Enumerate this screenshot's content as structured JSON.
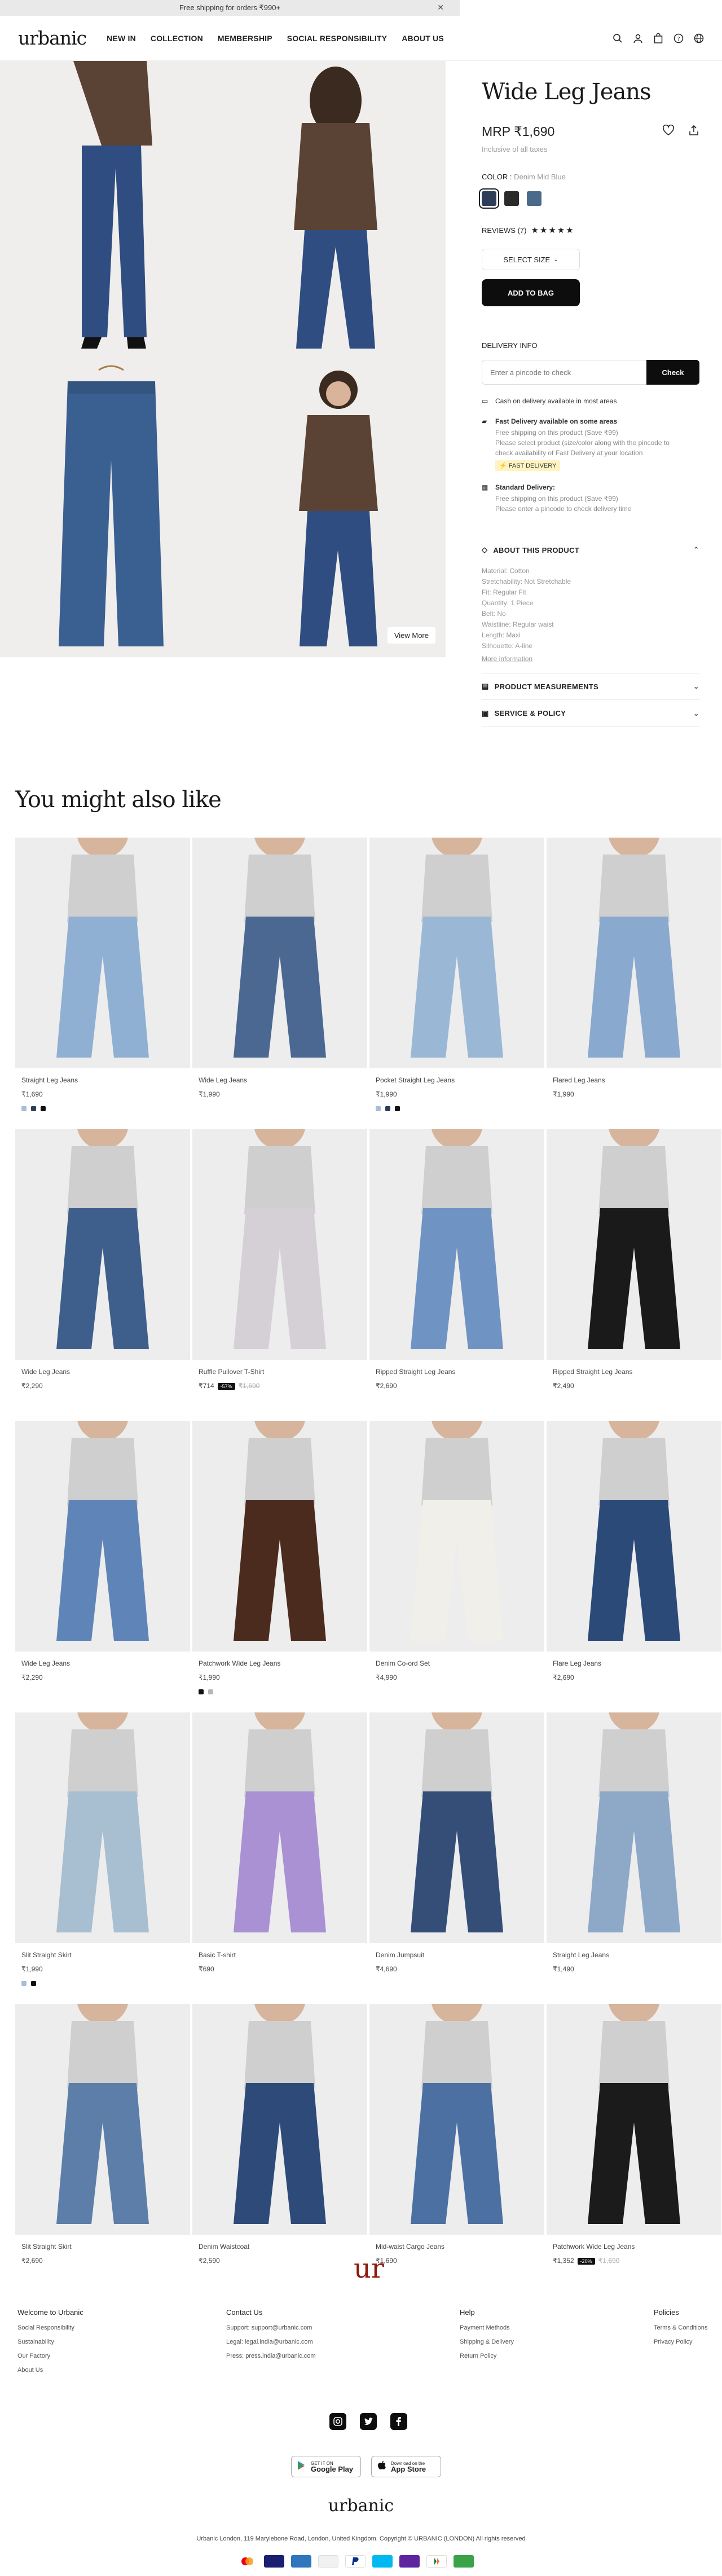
{
  "promo": {
    "text": "Free shipping for orders ₹990+",
    "close": "✕"
  },
  "header": {
    "logo": "urbanic",
    "nav": [
      "NEW IN",
      "COLLECTION",
      "MEMBERSHIP",
      "SOCIAL RESPONSIBILITY",
      "ABOUT US"
    ]
  },
  "gallery": {
    "view_more": "View More"
  },
  "product": {
    "title": "Wide Leg Jeans",
    "price": "MRP ₹1,690",
    "tax_note": "Inclusive of all taxes",
    "color_label": "COLOR : ",
    "color_value": "Denim Mid Blue",
    "swatches": [
      "#2e3e59",
      "#2b2b2b",
      "#4a6a8a"
    ],
    "reviews_label": "REVIEWS (7)",
    "stars": "★★★★★",
    "select_size": "SELECT SIZE",
    "add_to_bag": "ADD TO BAG",
    "delivery_label": "DELIVERY INFO",
    "pincode_placeholder": "Enter a pincode to check",
    "check": "Check",
    "cod": "Cash on delivery available in most areas",
    "fast_title": "Fast Delivery available on some areas",
    "fast_l1": "Free shipping on this product (Save ₹99)",
    "fast_l2": "Please select product (size/color along with the pincode to",
    "fast_l3": "check availability of Fast Delivery at your location",
    "fast_badge": "⚡ FAST DELIVERY",
    "std_title": "Standard Delivery:",
    "std_l1": "Free shipping on this product (Save ₹99)",
    "std_l2": "Please enter a pincode to check delivery time",
    "about": "ABOUT THIS PRODUCT",
    "attrs": [
      "Material: Cotton",
      "Stretchability: Not Stretchable",
      "Fit: Regular Fit",
      "Quantity: 1 Piece",
      "Belt: No",
      "Waistline: Regular waist",
      "Length: Maxi",
      "Silhouette: A-line"
    ],
    "more_info": "More information",
    "measurements": "PRODUCT MEASUREMENTS",
    "service": "SERVICE & POLICY"
  },
  "recs_title": "You might also like",
  "recs": [
    {
      "name": "Straight Leg Jeans",
      "price": "₹1,690",
      "dots": [
        "#a9bdd6",
        "#2c3e5c",
        "#111"
      ],
      "bg": "#8fb0d3"
    },
    {
      "name": "Wide Leg Jeans",
      "price": "₹1,990",
      "dots": [],
      "bg": "#4a6891"
    },
    {
      "name": "Pocket Straight Leg Jeans",
      "price": "₹1,990",
      "dots": [
        "#a9bdd6",
        "#2c3e5c",
        "#111"
      ],
      "bg": "#9ab8d6"
    },
    {
      "name": "Flared Leg Jeans",
      "price": "₹1,990",
      "dots": [],
      "bg": "#8aa9cf"
    },
    {
      "name": "Wide Leg Jeans",
      "price": "₹2,290",
      "dots": [],
      "bg": "#3e5f8c"
    },
    {
      "name": "Ruffle Pullover T-Shirt",
      "price": "₹714",
      "badge": "-57%",
      "old": "₹1,690",
      "dots": [],
      "bg": "#d4d0d6"
    },
    {
      "name": "Ripped Straight Leg Jeans",
      "price": "₹2,690",
      "dots": [],
      "bg": "#6f93c2"
    },
    {
      "name": "Ripped Straight Leg Jeans",
      "price": "₹2,490",
      "dots": [],
      "bg": "#1a1a1a"
    },
    {
      "name": "Wide Leg Jeans",
      "price": "₹2,290",
      "dots": [],
      "bg": "#5f85b8"
    },
    {
      "name": "Patchwork Wide Leg Jeans",
      "price": "₹1,990",
      "dots": [
        "#111",
        "#b7b7b7"
      ],
      "bg": "#4a2b1e"
    },
    {
      "name": "Denim Co-ord Set",
      "price": "₹4,990",
      "dots": [],
      "bg": "#f1efe9"
    },
    {
      "name": "Flare Leg Jeans",
      "price": "₹2,690",
      "dots": [],
      "bg": "#2b4a78"
    },
    {
      "name": "Slit Straight Skirt",
      "price": "₹1,990",
      "dots": [
        "#a9bdd6",
        "#111"
      ],
      "bg": "#a8bfd2"
    },
    {
      "name": "Basic T-shirt",
      "price": "₹690",
      "dots": [],
      "bg": "#a991d3"
    },
    {
      "name": "Denim Jumpsuit",
      "price": "₹4,690",
      "dots": [],
      "bg": "#344e78"
    },
    {
      "name": "Straight Leg Jeans",
      "price": "₹1,490",
      "dots": [],
      "bg": "#8ea8c8"
    },
    {
      "name": "Slit Straight Skirt",
      "price": "₹2,690",
      "dots": [],
      "bg": "#5d7ea8"
    },
    {
      "name": "Denim Waistcoat",
      "price": "₹2,590",
      "dots": [],
      "bg": "#2e4a78"
    },
    {
      "name": "Mid-waist Cargo Jeans",
      "price": "₹1,690",
      "dots": [],
      "bg": "#4d70a3"
    },
    {
      "name": "Patchwork Wide Leg Jeans",
      "price": "₹1,352",
      "badge": "-20%",
      "old": "₹1,690",
      "dots": [],
      "bg": "#1b1b1b"
    }
  ],
  "monogram": "ur",
  "footer": {
    "cols": [
      {
        "title": "Welcome to Urbanic",
        "links": [
          "Social Responsibility",
          "Sustainability",
          "Our Factory",
          "About Us"
        ]
      },
      {
        "title": "Contact Us",
        "links": [
          "Support: support@urbanic.com",
          "Legal: legal.india@urbanic.com",
          "Press: press.india@urbanic.com"
        ]
      },
      {
        "title": "Help",
        "links": [
          "Payment Methods",
          "Shipping & Delivery",
          "Return Policy"
        ]
      },
      {
        "title": "Policies",
        "links": [
          "Terms & Conditions",
          "Privacy Policy"
        ]
      }
    ],
    "google_small": "GET IT ON",
    "google": "Google Play",
    "apple_small": "Download on the",
    "apple": "App Store",
    "logo": "urbanic",
    "address": "Urbanic London, 119 Marylebone Road, London, United Kingdom. Copyright © URBANIC (LONDON) All rights reserved"
  }
}
